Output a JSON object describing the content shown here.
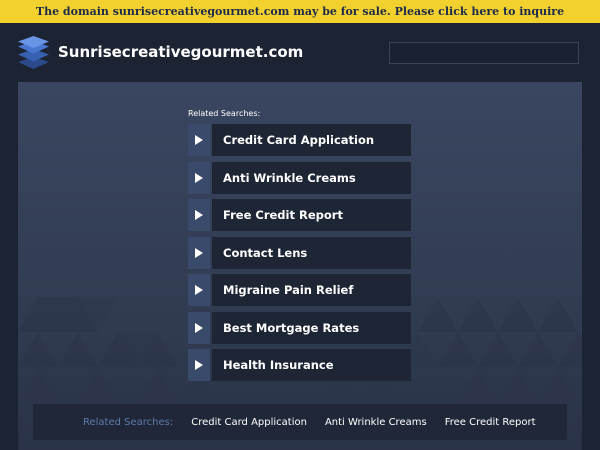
{
  "banner": {
    "text": "The domain sunrisecreativegourmet.com may be for sale. Please click here to inquire"
  },
  "header": {
    "site_name": "Sunrisecreativegourmet.com",
    "logo_icon": "layered-stack-icon",
    "search_placeholder": ""
  },
  "colors": {
    "banner_bg": "#f2d12f",
    "banner_text": "#1e2a4a",
    "page_bg": "#1c2333",
    "panel_bg": "#3a4660",
    "link_bg": "#1e2534",
    "arrow_bg": "#3a4a6a",
    "bottom_label": "#5e7aa8"
  },
  "related": {
    "label": "Related Searches:",
    "arrow_icon": "play-triangle-icon",
    "items": [
      "Credit Card Application",
      "Anti Wrinkle Creams",
      "Free Credit Report",
      "Contact Lens",
      "Migraine Pain Relief",
      "Best Mortgage Rates",
      "Health Insurance"
    ]
  },
  "bottom": {
    "label": "Related Searches:",
    "items": [
      "Credit Card Application",
      "Anti Wrinkle Creams",
      "Free Credit Report"
    ]
  }
}
